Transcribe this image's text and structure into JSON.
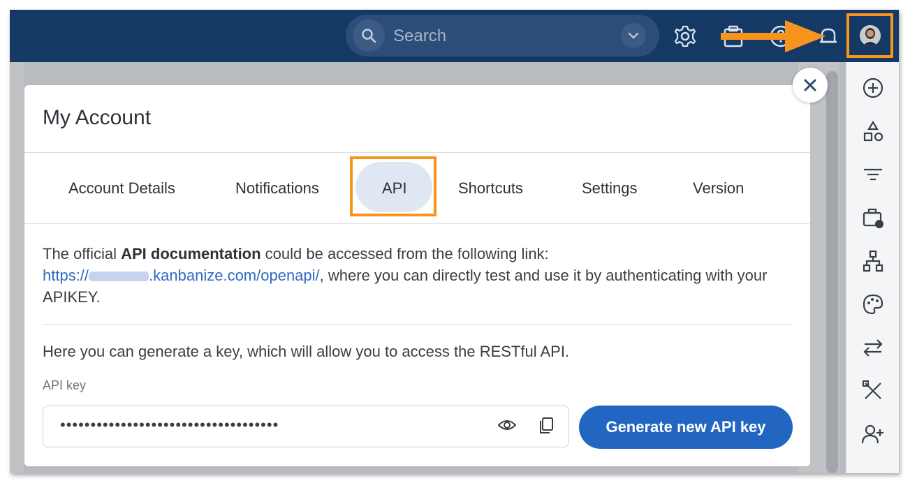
{
  "topbar": {
    "search_placeholder": "Search",
    "icons": [
      "search-icon",
      "chevron-down-icon",
      "gear-icon",
      "clipboard-icon",
      "help-icon",
      "bell-icon",
      "avatar"
    ]
  },
  "modal": {
    "title": "My Account",
    "tabs": [
      {
        "label": "Account Details"
      },
      {
        "label": "Notifications"
      },
      {
        "label": "API",
        "selected": true
      },
      {
        "label": "Shortcuts"
      },
      {
        "label": "Settings"
      },
      {
        "label": "Version"
      }
    ],
    "api": {
      "intro_before": "The official ",
      "intro_bold": "API documentation",
      "intro_after": " could be accessed from the following link:",
      "link_prefix": "https://",
      "link_suffix": ".kanbanize.com/openapi/",
      "link_tail": ", where you can directly test and use it by authenticating with your APIKEY.",
      "generate_text": "Here you can generate a key, which will allow you to access the RESTful API.",
      "key_label": "API key",
      "key_value": "••••••••••••••••••••••••••••••••••••",
      "generate_button": "Generate new API key"
    }
  },
  "colors": {
    "topbar": "#143964",
    "highlight": "#f7941d",
    "primary": "#2266c2",
    "link": "#2f6ac0",
    "tab_selected_bg": "#dfe7f3"
  }
}
